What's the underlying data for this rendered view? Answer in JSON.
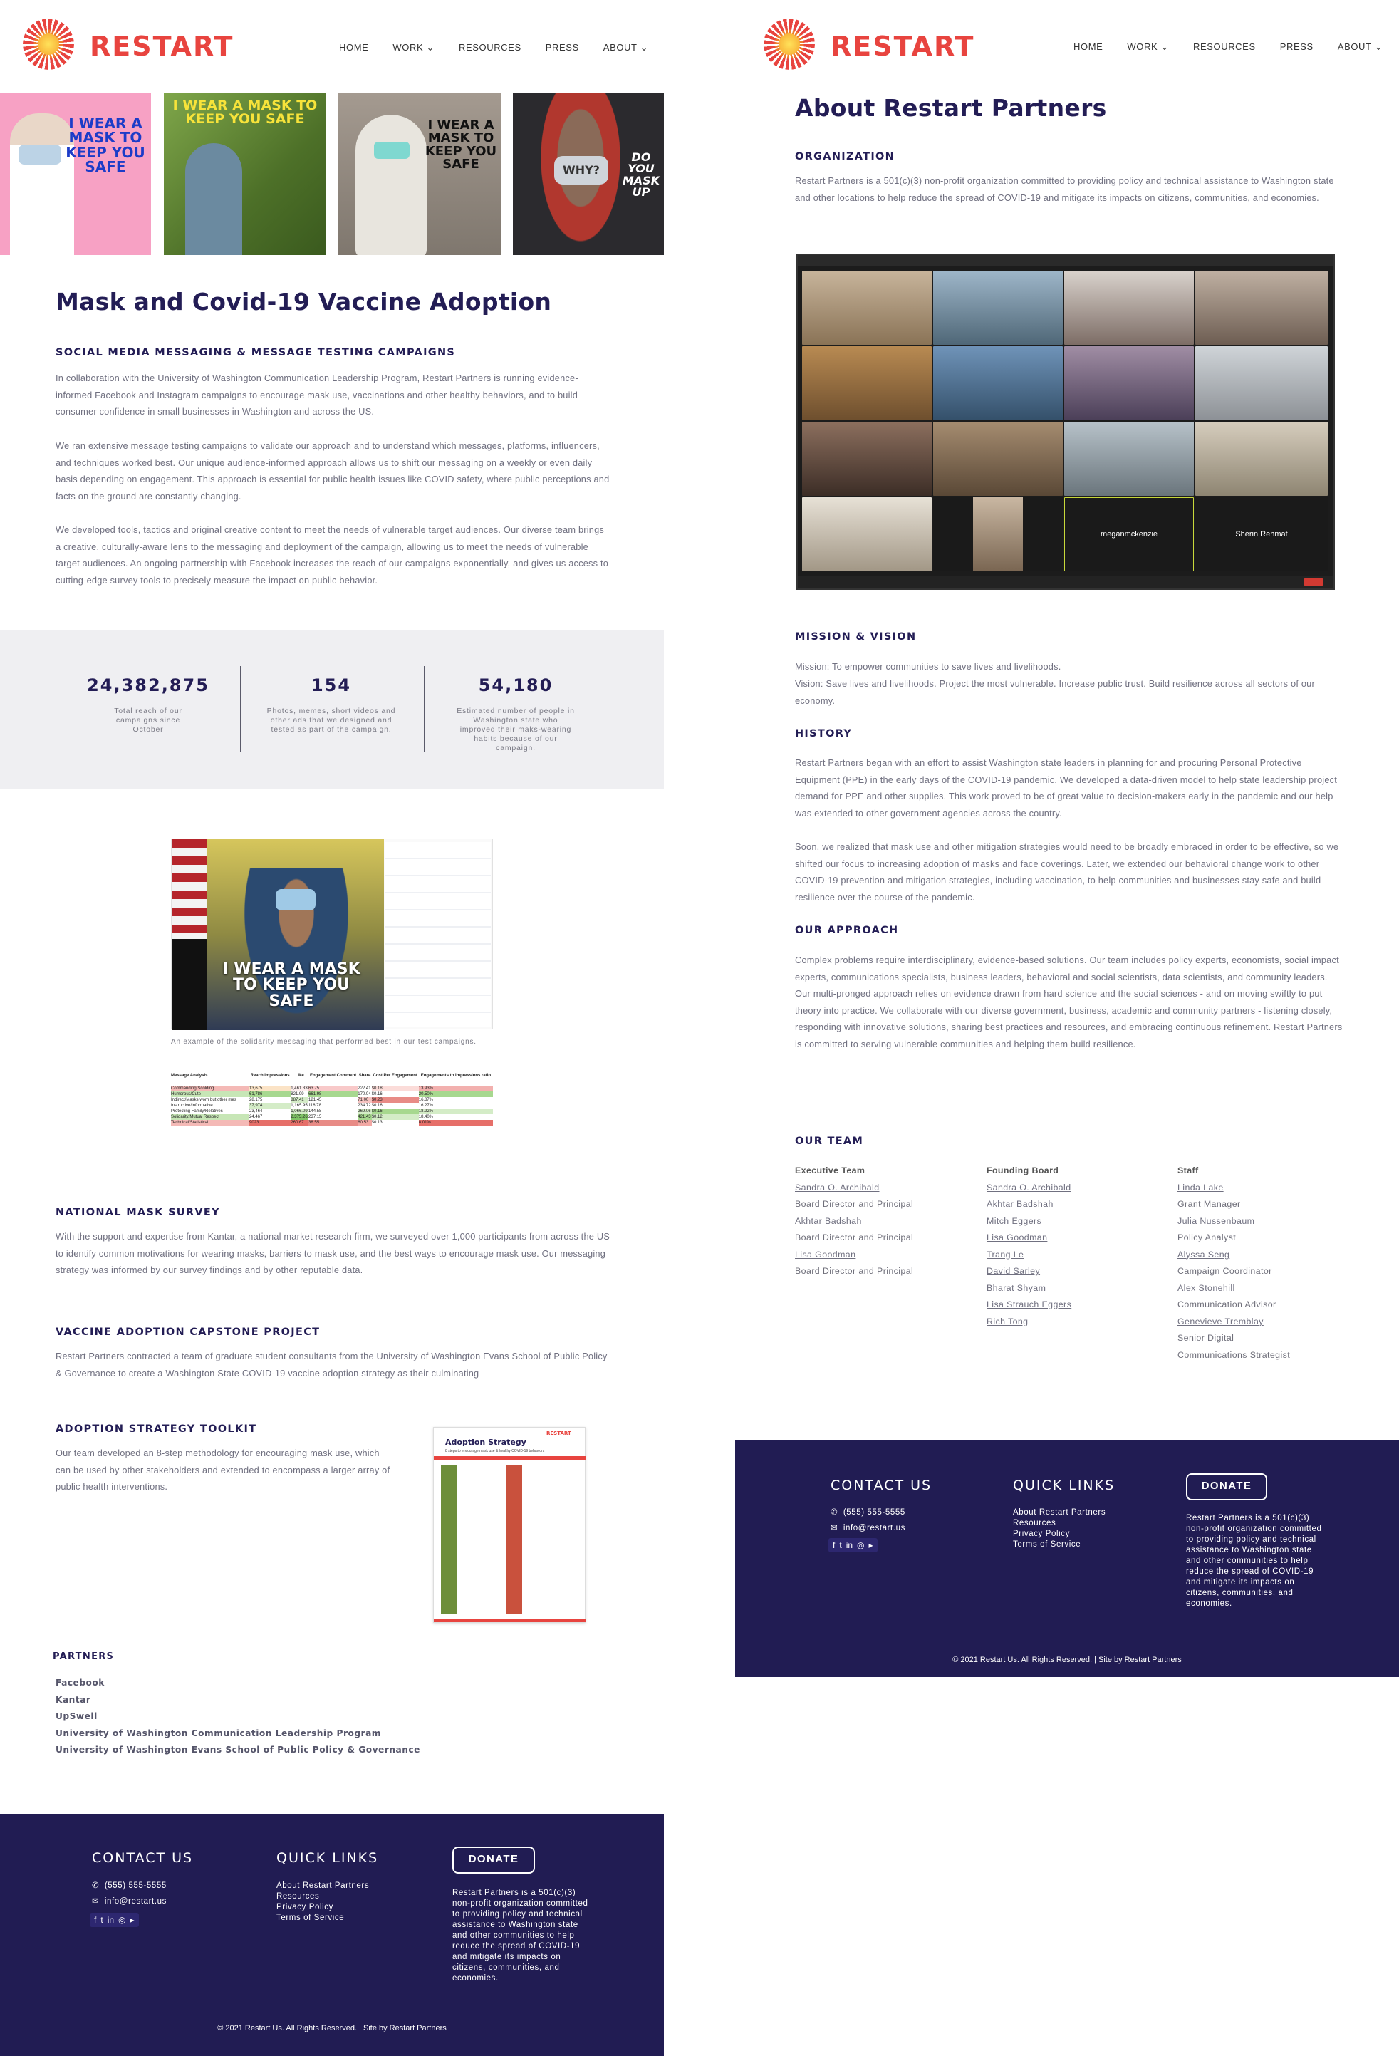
{
  "brand": {
    "name": "RESTART",
    "red": "#e8443f",
    "navy": "#231d55",
    "footer_bg": "#211c53"
  },
  "nav": {
    "home": "HOME",
    "work": "WORK",
    "resources": "RESOURCES",
    "press": "PRESS",
    "about": "ABOUT"
  },
  "tiles": [
    {
      "text": "I WEAR A MASK TO KEEP YOU SAFE",
      "bg": "#f7a1c4",
      "fg": "#1c3cc8"
    },
    {
      "text": "I WEAR A MASK TO KEEP YOU SAFE",
      "bg": "#5f8a3a",
      "fg": "#f7e33a"
    },
    {
      "text": "I WEAR A MASK TO KEEP YOU SAFE",
      "bg": "#8d857c",
      "fg": "#111111"
    },
    {
      "text": "DO YOU MASK UP",
      "bg": "#2b2a2e",
      "fg": "#ffffff",
      "mask_text": "WHY?"
    }
  ],
  "left": {
    "title": "Mask and Covid-19 Vaccine Adoption",
    "social_heading": "SOCIAL MEDIA MESSAGING & MESSAGE TESTING CAMPAIGNS",
    "p1": "In collaboration with the University of Washington Communication Leadership Program, Restart Partners is running evidence-informed Facebook and Instagram campaigns to encourage mask use, vaccinations and other healthy behaviors, and to build consumer confidence in small businesses in Washington and across the US.",
    "p2": "We ran extensive message testing campaigns to validate our approach and to understand which messages, platforms, influencers, and techniques worked best. Our unique audience-informed approach allows us to shift our messaging on a weekly or even daily basis depending on engagement. This approach is essential for public health issues like COVID safety, where public perceptions and facts on the ground are constantly changing.",
    "p3": "We developed tools, tactics and original creative content to meet the needs of vulnerable target audiences. Our diverse team brings a creative, culturally-aware lens to the messaging and deployment of the campaign, allowing us to meet the needs of vulnerable target audiences.  An ongoing partnership with Facebook increases the reach of our campaigns exponentially, and gives us access to cutting-edge survey tools to precisely measure the impact on public behavior.",
    "stats": [
      {
        "num": "24,382,875",
        "cap": "Total reach of our campaigns since October"
      },
      {
        "num": "154",
        "cap": "Photos, memes, short videos and other ads that we designed and tested as part of the campaign."
      },
      {
        "num": "54,180",
        "cap": "Estimated number of people in Washington state who improved their maks-wearing habits because of our campaign."
      }
    ],
    "video_caption_text": "I WEAR A MASK TO KEEP YOU SAFE",
    "image_caption": "An example of the solidarity messaging that performed best in our test campaigns.",
    "table": {
      "headers": [
        "Message Analysis",
        "Reach Impressions",
        "Like",
        "Engagement Comment",
        "Share",
        "Cost Per Engagement",
        "Engagements to Impressions ratio"
      ],
      "rows": [
        [
          "Commanding/Scolding",
          "13,675",
          "1,461.33",
          "63.75",
          "222.41",
          "$0.18",
          "13.93%"
        ],
        [
          "Humorous/Cute",
          "61,786",
          "821.99",
          "661.98",
          "170.04",
          "$0.16",
          "20.50%"
        ],
        [
          "Indirect/Masks worn but other mes",
          "28,175",
          "887.41",
          "121.45",
          "71.00",
          "$0.23",
          "16.87%"
        ],
        [
          "Instructive/Informative",
          "37,974",
          "1,165.95",
          "116.78",
          "234.72",
          "$0.16",
          "16.27%"
        ],
        [
          "Protecting Family/Relatives",
          "23,464",
          "1,066.09",
          "144.58",
          "269.06",
          "$0.16",
          "18.92%"
        ],
        [
          "Solidarity/Mutual Respect",
          "24,467",
          "2,375.26",
          "237.15",
          "421.43",
          "$0.12",
          "18.40%"
        ],
        [
          "Technical/Statistical",
          "9023",
          "260.67",
          "38.55",
          "60.53",
          "$0.13",
          "8.01%"
        ]
      ]
    },
    "survey_heading": "NATIONAL MASK SURVEY",
    "survey_p": "With the support and expertise from Kantar, a national market research firm, we surveyed over 1,000 participants from across the US to identify common motivations for wearing masks, barriers to mask use, and the best ways to encourage mask use. Our messaging strategy was informed by our survey findings and by other reputable data.",
    "capstone_heading": "VACCINE ADOPTION CAPSTONE PROJECT",
    "capstone_p": "Restart Partners contracted a team of graduate student consultants from the University of Washington Evans School of Public Policy & Governance to create a Washington State COVID-19 vaccine adoption strategy as their culminating",
    "toolkit_heading": "ADOPTION STRATEGY TOOLKIT",
    "toolkit_p": "Our team developed an 8-step methodology for encouraging mask use, which can be used by other stakeholders and extended to encompass a larger array of public health interventions.",
    "toolkit_doc": {
      "title": "Adoption Strategy",
      "subtitle": "8 steps to encourage mask use & healthy COVID-19 behaviors",
      "brand": "RESTART"
    },
    "partners_heading": "PARTNERS",
    "partners": [
      "Facebook",
      "Kantar",
      "UpSwell",
      "University of Washington Communication Leadership Program",
      "University of Washington Evans School of Public Policy & Governance"
    ]
  },
  "right": {
    "title": "About Restart Partners",
    "org_heading": "ORGANIZATION",
    "org_p": "Restart Partners is a 501(c)(3) non-profit organization committed to providing policy and technical assistance to Washington state and other locations to help reduce the spread of COVID-19 and mitigate its impacts on citizens, communities, and economies.",
    "zoom_names": [
      "meganmckenzie",
      "Sherin Rehmat"
    ],
    "mission_heading": "MISSION & VISION",
    "mission_p1": "Mission: To empower communities to save lives and livelihoods.",
    "mission_p2": "Vision: Save lives and livelihoods. Project the most vulnerable. Increase public trust. Build resilience across all sectors of our economy.",
    "history_heading": "HISTORY",
    "history_p1": "Restart Partners began with an effort to assist Washington state leaders in planning for and procuring Personal Protective Equipment (PPE) in the early days of the COVID-19 pandemic. We developed a data-driven model to help state leadership project demand for PPE and other supplies. This work proved to be of great value to decision-makers early in the pandemic and our help was extended to other government agencies across the country.",
    "history_p2": "Soon, we realized that mask use and other mitigation strategies would need to be broadly embraced in order to be effective, so we shifted our focus to increasing adoption of masks and face coverings. Later, we extended our behavioral change work to other COVID-19 prevention and mitigation strategies, including vaccination, to help communities and businesses stay safe and build resilience over the course of the pandemic.",
    "approach_heading": "OUR APPROACH",
    "approach_p": "Complex problems require interdisciplinary, evidence-based solutions. Our team includes policy experts, economists, social impact experts, communications specialists, business leaders, behavioral and social scientists, data scientists, and community leaders. Our multi-pronged approach relies on evidence drawn from hard science and the social sciences - and on moving swiftly to put theory into practice. We collaborate with our diverse government, business, academic and community partners - listening closely, responding with innovative solutions, sharing best practices and resources, and embracing continuous refinement. Restart Partners is committed to serving vulnerable communities and helping them build resilience.",
    "team_heading": "OUR TEAM",
    "exec_heading": "Executive Team",
    "exec": [
      {
        "text": "Sandra O. Archibald",
        "link": true
      },
      {
        "text": "Board Director and Principal",
        "link": false
      },
      {
        "text": "Akhtar Badshah",
        "link": true
      },
      {
        "text": "Board Director and Principal",
        "link": false
      },
      {
        "text": "Lisa Goodman",
        "link": true
      },
      {
        "text": "Board Director and Principal",
        "link": false
      }
    ],
    "board_heading": "Founding Board",
    "board": [
      "Sandra O. Archibald",
      "Akhtar Badshah",
      "Mitch Eggers",
      "Lisa Goodman",
      "Trang Le",
      "David Sarley",
      "Bharat Shyam",
      "Lisa Strauch Eggers",
      "Rich Tong"
    ],
    "staff_heading": "Staff",
    "staff": [
      {
        "text": "Linda Lake",
        "link": true
      },
      {
        "text": "Grant Manager",
        "link": false
      },
      {
        "text": "Julia Nussenbaum",
        "link": true
      },
      {
        "text": "Policy Analyst",
        "link": false
      },
      {
        "text": "Alyssa Seng",
        "link": true
      },
      {
        "text": "Campaign Coordinator",
        "link": false
      },
      {
        "text": "Alex Stonehill",
        "link": true
      },
      {
        "text": "Communication Advisor",
        "link": false
      },
      {
        "text": "Genevieve Tremblay",
        "link": true
      },
      {
        "text": "Senior Digital",
        "link": false
      },
      {
        "text": "Communications Strategist",
        "link": false
      }
    ]
  },
  "footer": {
    "contact_heading": "CONTACT US",
    "phone": "(555) 555-5555",
    "email": "info@restart.us",
    "links_heading": "QUICK LINKS",
    "links": [
      "About Restart Partners",
      "Resources",
      "Privacy Policy",
      "Terms of Service"
    ],
    "donate": "DONATE",
    "about": "Restart Partners is a 501(c)(3) non-profit organization committed to providing policy and technical assistance to Washington state and other communities to help reduce the spread of COVID-19 and mitigate its impacts on citizens, communities, and economies.",
    "copyright": "© 2021 Restart Us. All Rights Reserved. | Site by Restart Partners"
  }
}
